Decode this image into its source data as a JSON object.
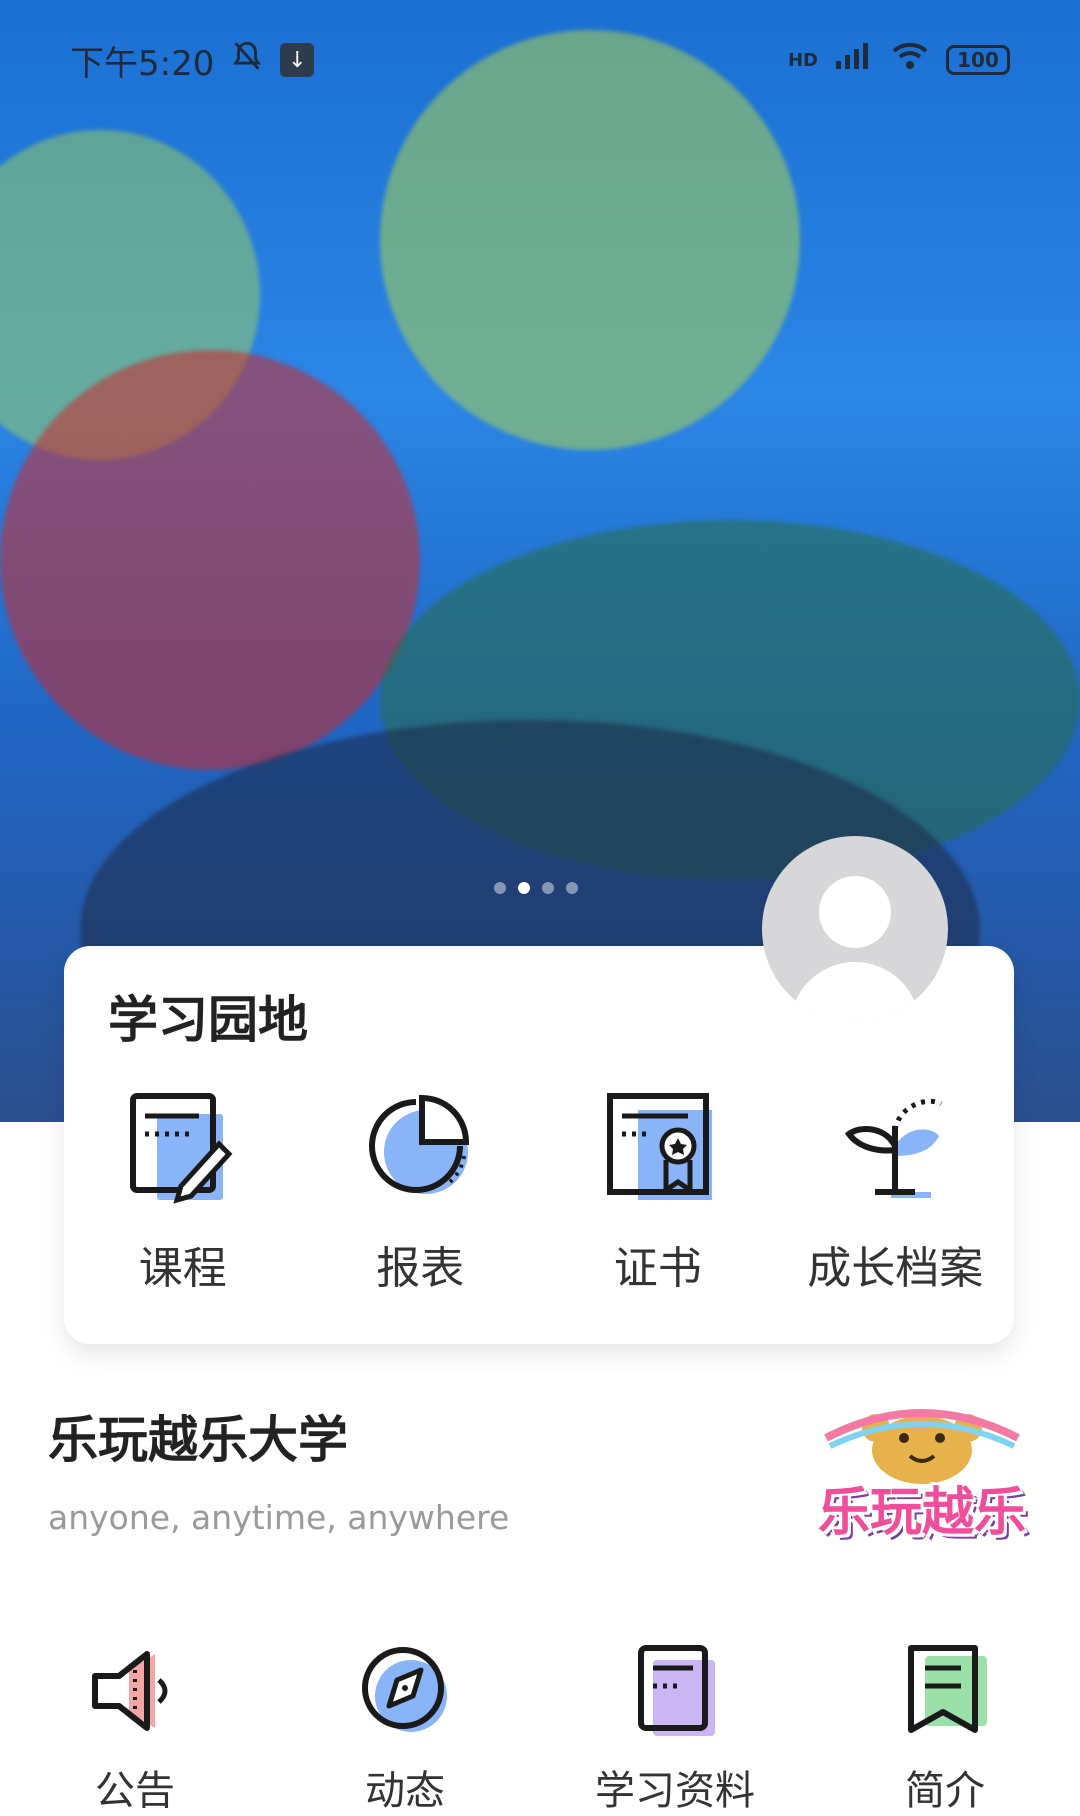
{
  "status_bar": {
    "time": "下午5:20",
    "network": "HD",
    "battery": "100"
  },
  "carousel": {
    "slides": 4,
    "active_index": 1
  },
  "learning_card": {
    "title": "学习园地",
    "items": [
      {
        "label": "课程",
        "icon": "course-icon"
      },
      {
        "label": "报表",
        "icon": "report-pie-icon"
      },
      {
        "label": "证书",
        "icon": "certificate-icon"
      },
      {
        "label": "成长档案",
        "icon": "growth-sprout-icon"
      }
    ]
  },
  "university": {
    "title": "乐玩越乐大学",
    "subtitle": "anyone, anytime, anywhere",
    "logo_text": "乐玩越乐"
  },
  "bottom_nav": [
    {
      "label": "公告",
      "icon": "megaphone-icon"
    },
    {
      "label": "动态",
      "icon": "compass-icon"
    },
    {
      "label": "学习资料",
      "icon": "notebook-icon"
    },
    {
      "label": "简介",
      "icon": "bookmark-icon"
    }
  ],
  "colors": {
    "accent_blue": "#8ab4f8",
    "accent_red": "#f4a6a6",
    "accent_purple": "#c9b6f2",
    "accent_green": "#9be0a9"
  }
}
